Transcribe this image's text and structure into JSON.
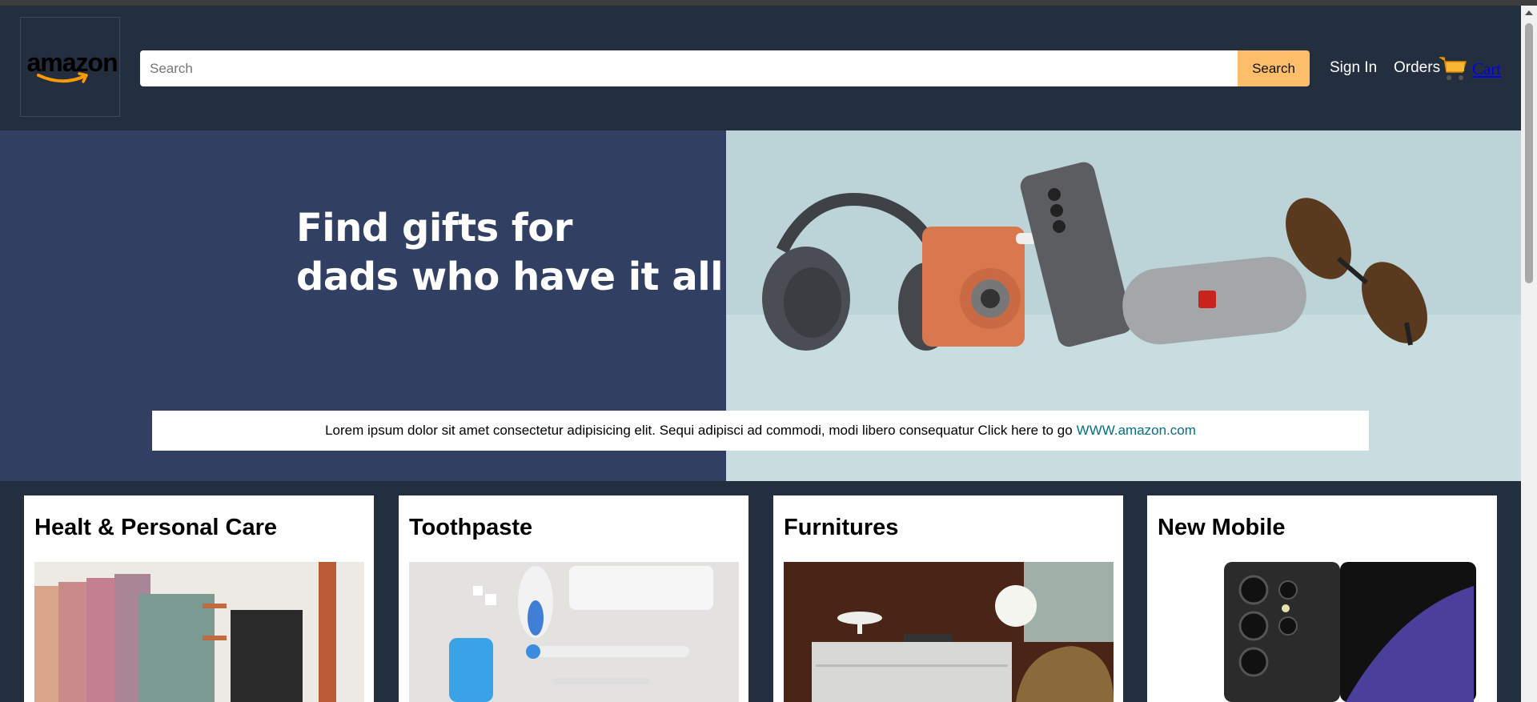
{
  "header": {
    "logo_text": "amazon",
    "search": {
      "placeholder": "Search",
      "button_label": "Search"
    },
    "nav": {
      "sign_in": "Sign In",
      "orders": "Orders",
      "cart": "Cart"
    }
  },
  "hero": {
    "title_line1": "Find gifts for",
    "title_line2": "dads who have it all",
    "message": "Lorem ipsum dolor sit amet consectetur adipisicing elit. Sequi adipisci ad commodi, modi libero consequatur Click here to go",
    "link_text": "WWW.amazon.com"
  },
  "cards": [
    {
      "title": "Healt & Personal Care",
      "image": "hanging-towels-image"
    },
    {
      "title": "Toothpaste",
      "image": "toothpaste-items-image"
    },
    {
      "title": "Furnitures",
      "image": "furniture-room-image"
    },
    {
      "title": "New Mobile",
      "image": "smartphone-image"
    }
  ],
  "colors": {
    "header_bg": "#232f3e",
    "search_button": "#febd69",
    "hero_left_bg": "#313f62",
    "hero_right_bg": "#bcd4d8",
    "link_teal": "#007185"
  }
}
